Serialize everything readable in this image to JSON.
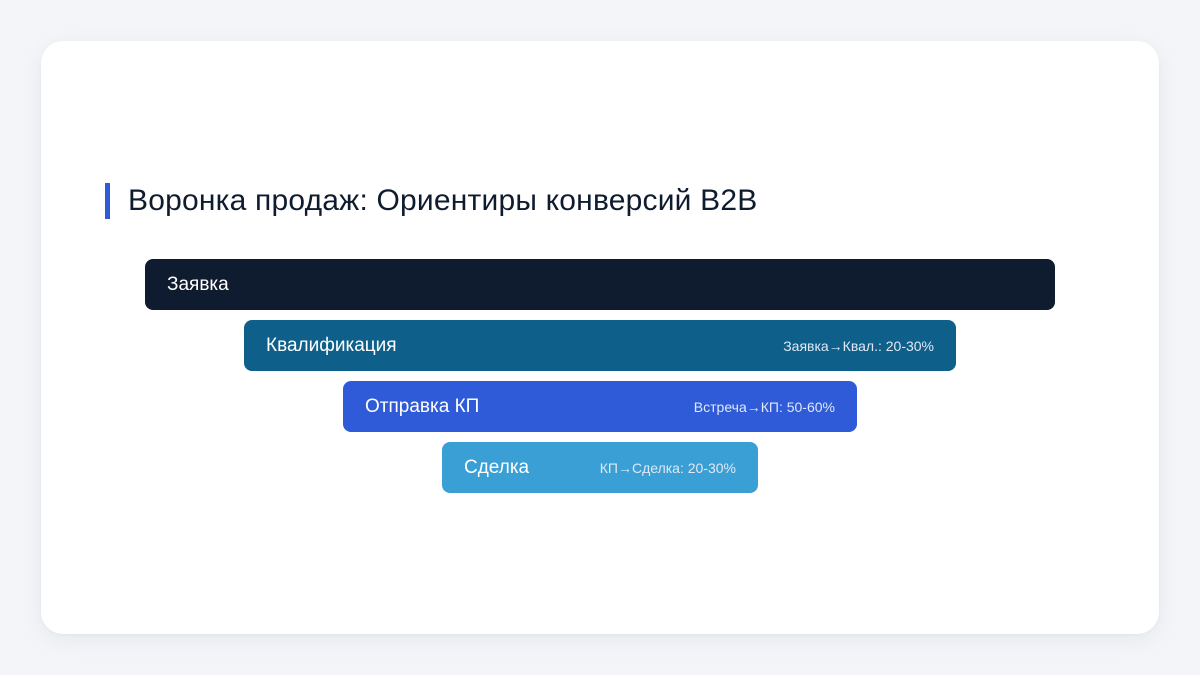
{
  "slide": {
    "title": "Воронка продаж: Ориентиры конверсий B2B",
    "accent_color": "#2f5bd8"
  },
  "funnel": {
    "stages": [
      {
        "label": "Заявка",
        "rate": "",
        "color": "#0f1b2e"
      },
      {
        "label": "Квалификация",
        "rate": "Заявка→Квал.: 20-30%",
        "color": "#0e5f8a"
      },
      {
        "label": "Отправка КП",
        "rate": "Встреча→КП: 50-60%",
        "color": "#2f5bd8"
      },
      {
        "label": "Сделка",
        "rate": "КП→Сделка: 20-30%",
        "color": "#3a9fd5"
      }
    ]
  }
}
